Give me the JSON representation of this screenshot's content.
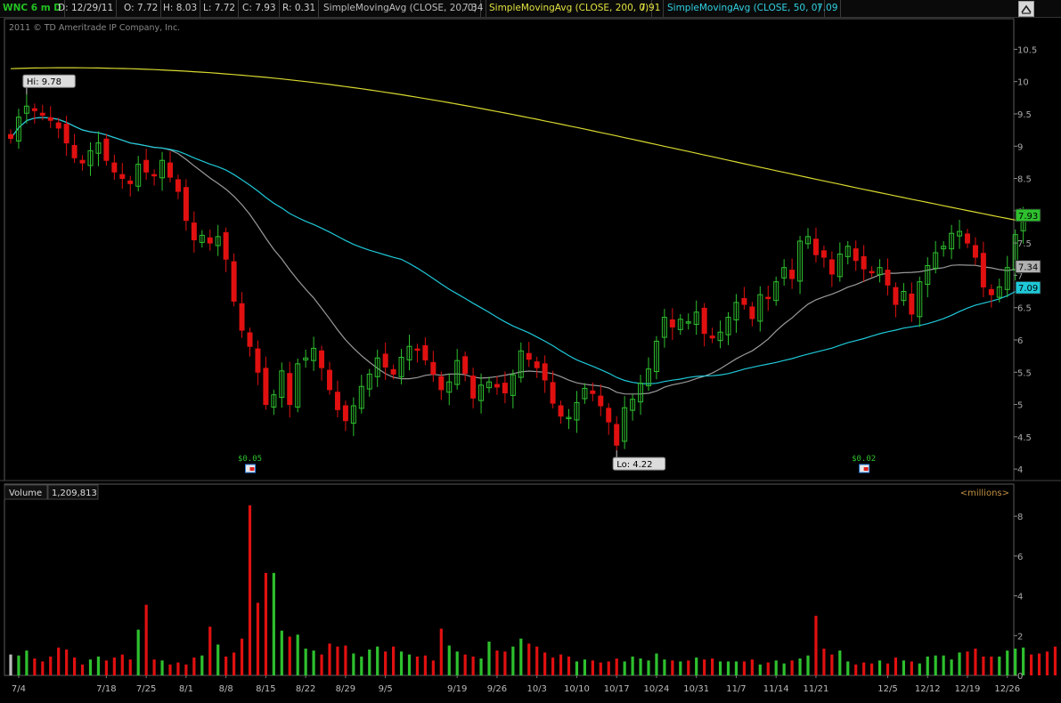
{
  "header": {
    "symbol": "WNC 6 m D",
    "date": "D: 12/29/11",
    "open": "O: 7.72",
    "high": "H: 8.03",
    "low": "L: 7.72",
    "close": "C: 7.93",
    "range": "R: 0.31",
    "sma20_label": "SimpleMovingAvg (CLOSE, 20, 0)",
    "sma20_value": "7.34",
    "sma200_label": "SimpleMovingAvg (CLOSE, 200, 0)",
    "sma200_value": "7.91",
    "sma50_label": "SimpleMovingAvg (CLOSE, 50, 0)",
    "sma50_value": "7.09"
  },
  "colors": {
    "up": "#2ec02e",
    "down": "#e01010",
    "sma20": "#9a9a9a",
    "sma50": "#1ec8d8",
    "sma200": "#d8d830",
    "symbol": "#22c022"
  },
  "copyright": "2011 © TD Ameritrade IP Company, Inc.",
  "chart_data": [
    {
      "type": "candlestick",
      "y_ticks": [
        "4",
        "4.5",
        "5",
        "5.5",
        "6",
        "6.5",
        "7",
        "7.5",
        "8",
        "8.5",
        "9",
        "9.5",
        "10",
        "10.5"
      ],
      "ylim": [
        3.85,
        10.85
      ],
      "x_tick_labels": [
        "7/4",
        "7/18",
        "7/25",
        "8/1",
        "8/8",
        "8/15",
        "8/22",
        "8/29",
        "9/5",
        "9/19",
        "9/26",
        "10/3",
        "10/10",
        "10/17",
        "10/24",
        "10/31",
        "11/7",
        "11/14",
        "11/21",
        "12/5",
        "12/12",
        "12/19",
        "12/26"
      ],
      "x_tick_index": [
        1,
        12,
        17,
        22,
        27,
        32,
        37,
        42,
        47,
        56,
        61,
        66,
        71,
        76,
        81,
        86,
        91,
        96,
        101,
        110,
        115,
        120,
        125
      ],
      "num_days": 128,
      "closes": [
        9.12,
        9.45,
        9.62,
        9.55,
        9.48,
        9.4,
        9.28,
        9.05,
        8.82,
        8.74,
        8.93,
        9.05,
        8.78,
        8.6,
        8.5,
        8.42,
        8.72,
        8.6,
        8.55,
        8.78,
        8.52,
        8.3,
        7.85,
        7.55,
        7.62,
        7.5,
        7.6,
        7.25,
        6.6,
        6.15,
        5.9,
        5.5,
        5.0,
        5.15,
        5.52,
        5.0,
        5.63,
        5.72,
        5.87,
        5.57,
        5.23,
        4.92,
        4.75,
        4.98,
        5.28,
        5.47,
        5.72,
        5.58,
        5.47,
        5.73,
        5.9,
        5.85,
        5.69,
        5.47,
        5.23,
        5.35,
        5.68,
        5.48,
        5.1,
        5.3,
        5.35,
        5.27,
        5.18,
        5.46,
        5.83,
        5.7,
        5.57,
        5.38,
        5.02,
        4.82,
        4.8,
        5.03,
        5.25,
        5.17,
        4.98,
        4.73,
        4.37,
        4.95,
        5.08,
        5.33,
        5.55,
        5.98,
        6.35,
        6.2,
        6.32,
        6.28,
        6.43,
        6.1,
        6.03,
        6.12,
        6.35,
        6.58,
        6.55,
        6.33,
        6.7,
        6.65,
        6.9,
        7.12,
        6.95,
        7.53,
        7.6,
        7.32,
        7.28,
        7.02,
        7.33,
        7.45,
        7.23,
        7.1,
        7.05,
        7.12,
        6.85,
        6.55,
        6.75,
        6.4,
        6.9,
        7.15,
        7.35,
        7.45,
        7.65,
        7.68,
        7.5,
        7.28,
        6.82,
        6.7,
        6.82,
        7.12,
        7.63,
        7.93
      ],
      "high_label": "Hi: 9.78",
      "low_label": "Lo: 4.22",
      "last_labels": [
        {
          "value": "7.93",
          "color": "#2ec02e"
        },
        {
          "value": "7.34",
          "color": "#b0b0b0"
        },
        {
          "value": "7.09",
          "color": "#1ec8d8"
        }
      ],
      "dividends": [
        {
          "label": "$0.05",
          "index": 30
        },
        {
          "label": "$0.02",
          "index": 107
        }
      ]
    },
    {
      "type": "bar",
      "title": "Volume",
      "value": "1,209,813",
      "unit_label": "<millions>",
      "y_ticks": [
        "0",
        "2",
        "4",
        "6",
        "8"
      ],
      "ylim": [
        0,
        8.9
      ],
      "volumes": [
        1.05,
        1.0,
        1.25,
        0.85,
        0.7,
        0.95,
        1.4,
        1.3,
        0.9,
        0.55,
        0.8,
        0.95,
        0.75,
        0.9,
        1.05,
        0.8,
        2.3,
        3.55,
        0.8,
        0.75,
        0.55,
        0.65,
        0.55,
        0.9,
        1.0,
        2.45,
        1.55,
        0.95,
        1.15,
        1.85,
        8.55,
        3.65,
        5.15,
        5.15,
        2.25,
        1.95,
        2.05,
        1.35,
        1.25,
        1.05,
        1.6,
        1.45,
        1.5,
        1.1,
        0.95,
        1.3,
        1.45,
        1.2,
        1.45,
        1.2,
        1.05,
        0.95,
        1.0,
        0.75,
        2.35,
        1.5,
        1.2,
        1.05,
        0.95,
        0.85,
        1.7,
        1.25,
        1.2,
        1.45,
        1.85,
        1.6,
        1.45,
        1.15,
        0.9,
        1.05,
        0.95,
        0.7,
        0.8,
        0.75,
        0.65,
        0.7,
        0.85,
        0.7,
        0.95,
        0.85,
        0.75,
        1.1,
        0.8,
        0.75,
        0.7,
        0.75,
        0.9,
        0.8,
        0.85,
        0.7,
        0.7,
        0.7,
        0.7,
        0.8,
        0.55,
        0.65,
        0.75,
        0.6,
        0.75,
        0.85,
        1.0,
        3.0,
        1.35,
        1.05,
        1.25,
        0.7,
        0.55,
        0.65,
        0.6,
        0.75,
        0.6,
        0.9,
        0.75,
        0.7,
        0.6,
        0.95,
        1.0,
        1.0,
        0.8,
        1.15,
        1.2,
        1.35,
        0.95,
        0.95,
        0.95,
        1.25,
        1.35,
        1.4,
        1.05,
        1.1,
        1.2,
        1.45
      ]
    }
  ]
}
